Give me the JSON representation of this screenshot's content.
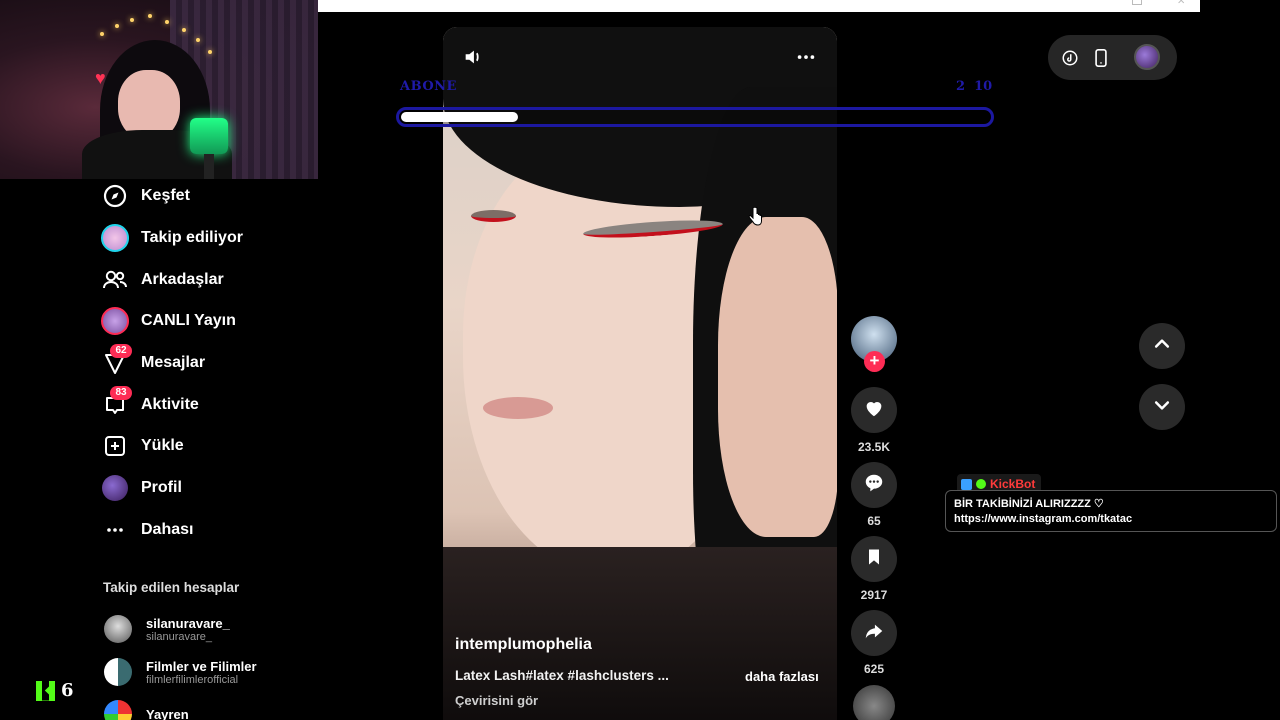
{
  "sidebar": {
    "items": [
      {
        "label": "Keşfet",
        "icon": "compass-icon"
      },
      {
        "label": "Takip ediliyor",
        "icon": "following-avatar-icon"
      },
      {
        "label": "Arkadaşlar",
        "icon": "friends-icon"
      },
      {
        "label": "CANLI Yayın",
        "icon": "live-avatar-icon"
      },
      {
        "label": "Mesajlar",
        "icon": "message-icon",
        "badge": "62"
      },
      {
        "label": "Aktivite",
        "icon": "activity-icon",
        "badge": "83"
      },
      {
        "label": "Yükle",
        "icon": "upload-icon"
      },
      {
        "label": "Profil",
        "icon": "profile-avatar-icon"
      },
      {
        "label": "Dahası",
        "icon": "more-icon"
      }
    ],
    "followed_title": "Takip edilen hesaplar",
    "followed": [
      {
        "name": "silanuravare_",
        "handle": "silanuravare_"
      },
      {
        "name": "Filmler ve Filimler",
        "handle": "filmlerfilimlerofficial"
      },
      {
        "name": "Yayren",
        "handle": ""
      }
    ]
  },
  "overlay": {
    "subscribe_label": "ABONE",
    "goal_current": "2",
    "goal_target": "10",
    "goal_progress": 0.2,
    "kick_viewers": "6"
  },
  "video": {
    "username": "intemplumophelia",
    "description": "Latex Lash#latex #lashclusters ...",
    "more_label": "daha fazlası",
    "translate_label": "Çevirisini gör"
  },
  "actions": {
    "likes": "23.5K",
    "comments": "65",
    "saves": "2917",
    "shares": "625"
  },
  "chat": {
    "bot_name": "KickBot",
    "line1": "BİR TAKİBİNİZİ ALIRIZZZZ ♡",
    "line2": "https://www.instagram.com/tkatac"
  },
  "colors": {
    "accent": "#fe2c55",
    "overlay_blue": "#1c18a0",
    "kick_green": "#53fc18",
    "live_ring": "#20d5ec"
  }
}
